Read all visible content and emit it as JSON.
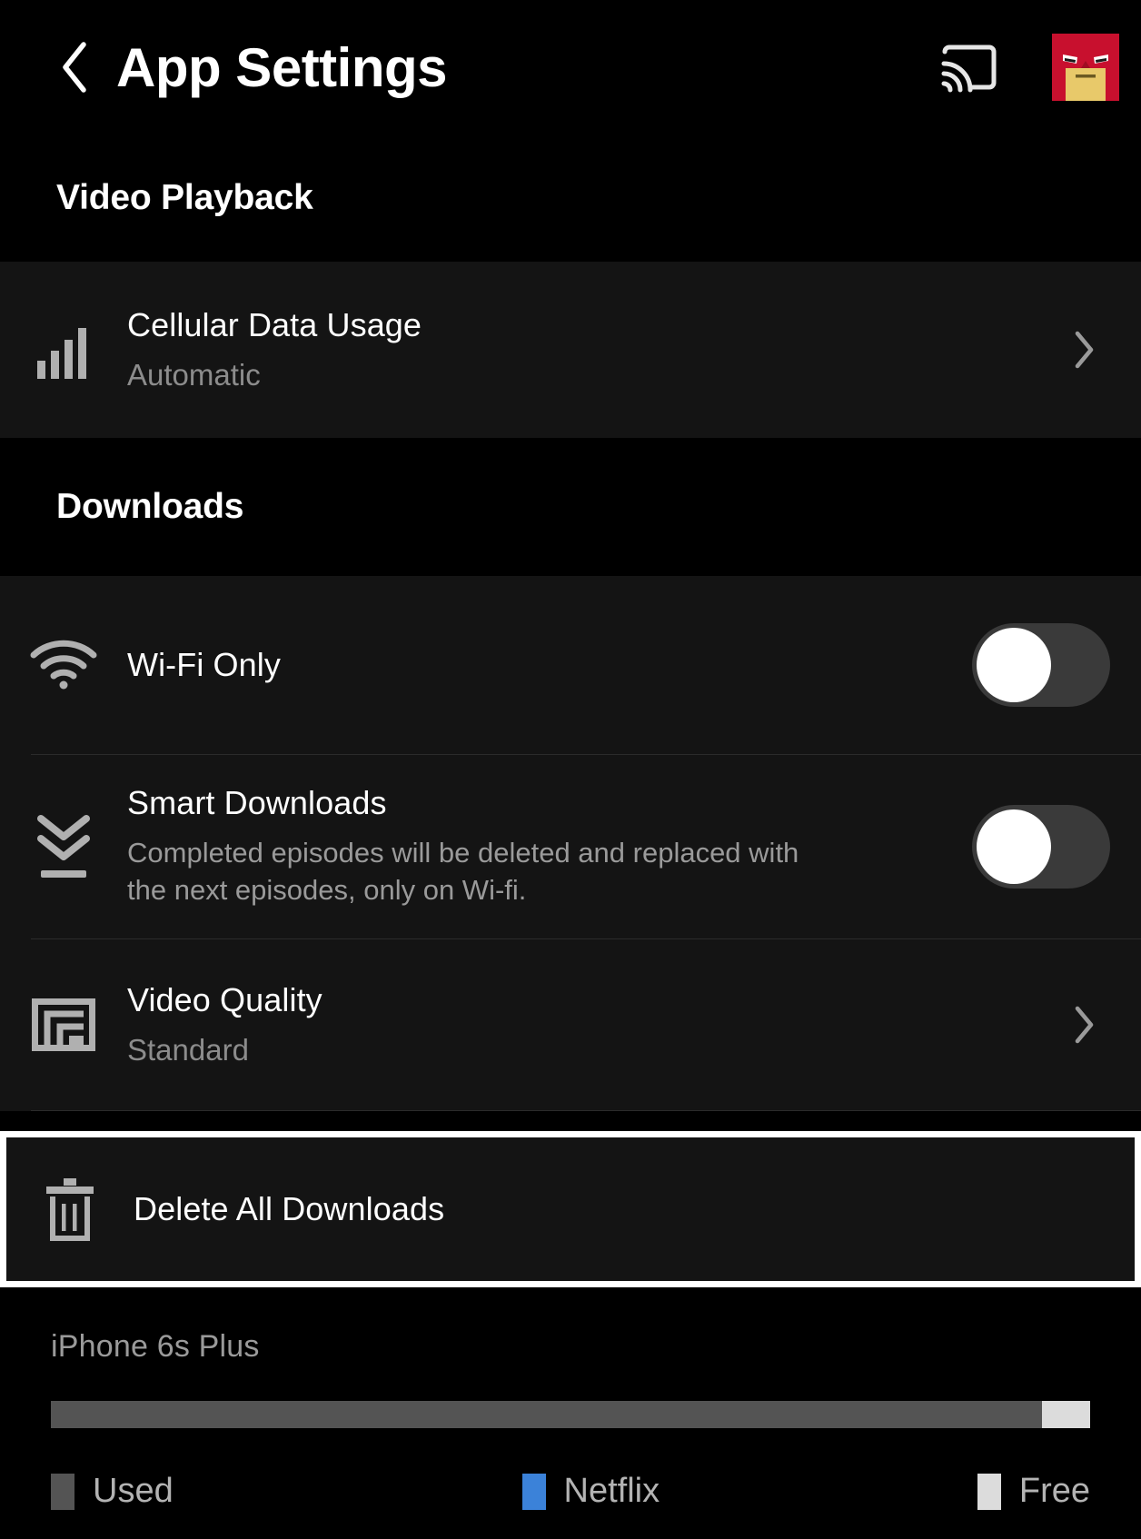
{
  "header": {
    "back_icon": "chevron-left-icon",
    "title": "App Settings",
    "cast_icon": "cast-icon",
    "avatar_icon": "profile-avatar"
  },
  "sections": [
    {
      "title": "Video Playback",
      "rows": [
        {
          "icon": "signal-bars-icon",
          "title": "Cellular Data Usage",
          "subtitle": "Automatic",
          "accessory": "chevron-right-icon"
        }
      ]
    },
    {
      "title": "Downloads",
      "rows": [
        {
          "icon": "wifi-icon",
          "title": "Wi-Fi Only",
          "accessory": "toggle",
          "toggle_state": "off"
        },
        {
          "icon": "download-chevrons-icon",
          "title": "Smart Downloads",
          "description": "Completed episodes will be deleted and replaced with the next episodes, only on Wi-fi.",
          "accessory": "toggle",
          "toggle_state": "off"
        },
        {
          "icon": "video-quality-icon",
          "title": "Video Quality",
          "subtitle": "Standard",
          "accessory": "chevron-right-icon"
        }
      ]
    }
  ],
  "delete_row": {
    "icon": "trash-icon",
    "title": "Delete All Downloads",
    "highlighted": true
  },
  "storage": {
    "device": "iPhone 6s Plus",
    "segments": [
      {
        "name": "Used",
        "color": "#545454",
        "percent": 95.4
      },
      {
        "name": "Netflix",
        "color": "#3b82d9",
        "percent": 0.0
      },
      {
        "name": "Free",
        "color": "#dcdcdc",
        "percent": 4.6
      }
    ],
    "legend": [
      {
        "label": "Used",
        "color": "#545454"
      },
      {
        "label": "Netflix",
        "color": "#3b82d9"
      },
      {
        "label": "Free",
        "color": "#dcdcdc"
      }
    ]
  },
  "colors": {
    "background": "#000000",
    "row_background": "#141414",
    "primary_text": "#ffffff",
    "secondary_text": "#8c8c8c",
    "highlight_border": "#ffffff",
    "netflix_blue": "#3b82d9",
    "avatar_red": "#c8102e",
    "avatar_face": "#e8c96a"
  }
}
